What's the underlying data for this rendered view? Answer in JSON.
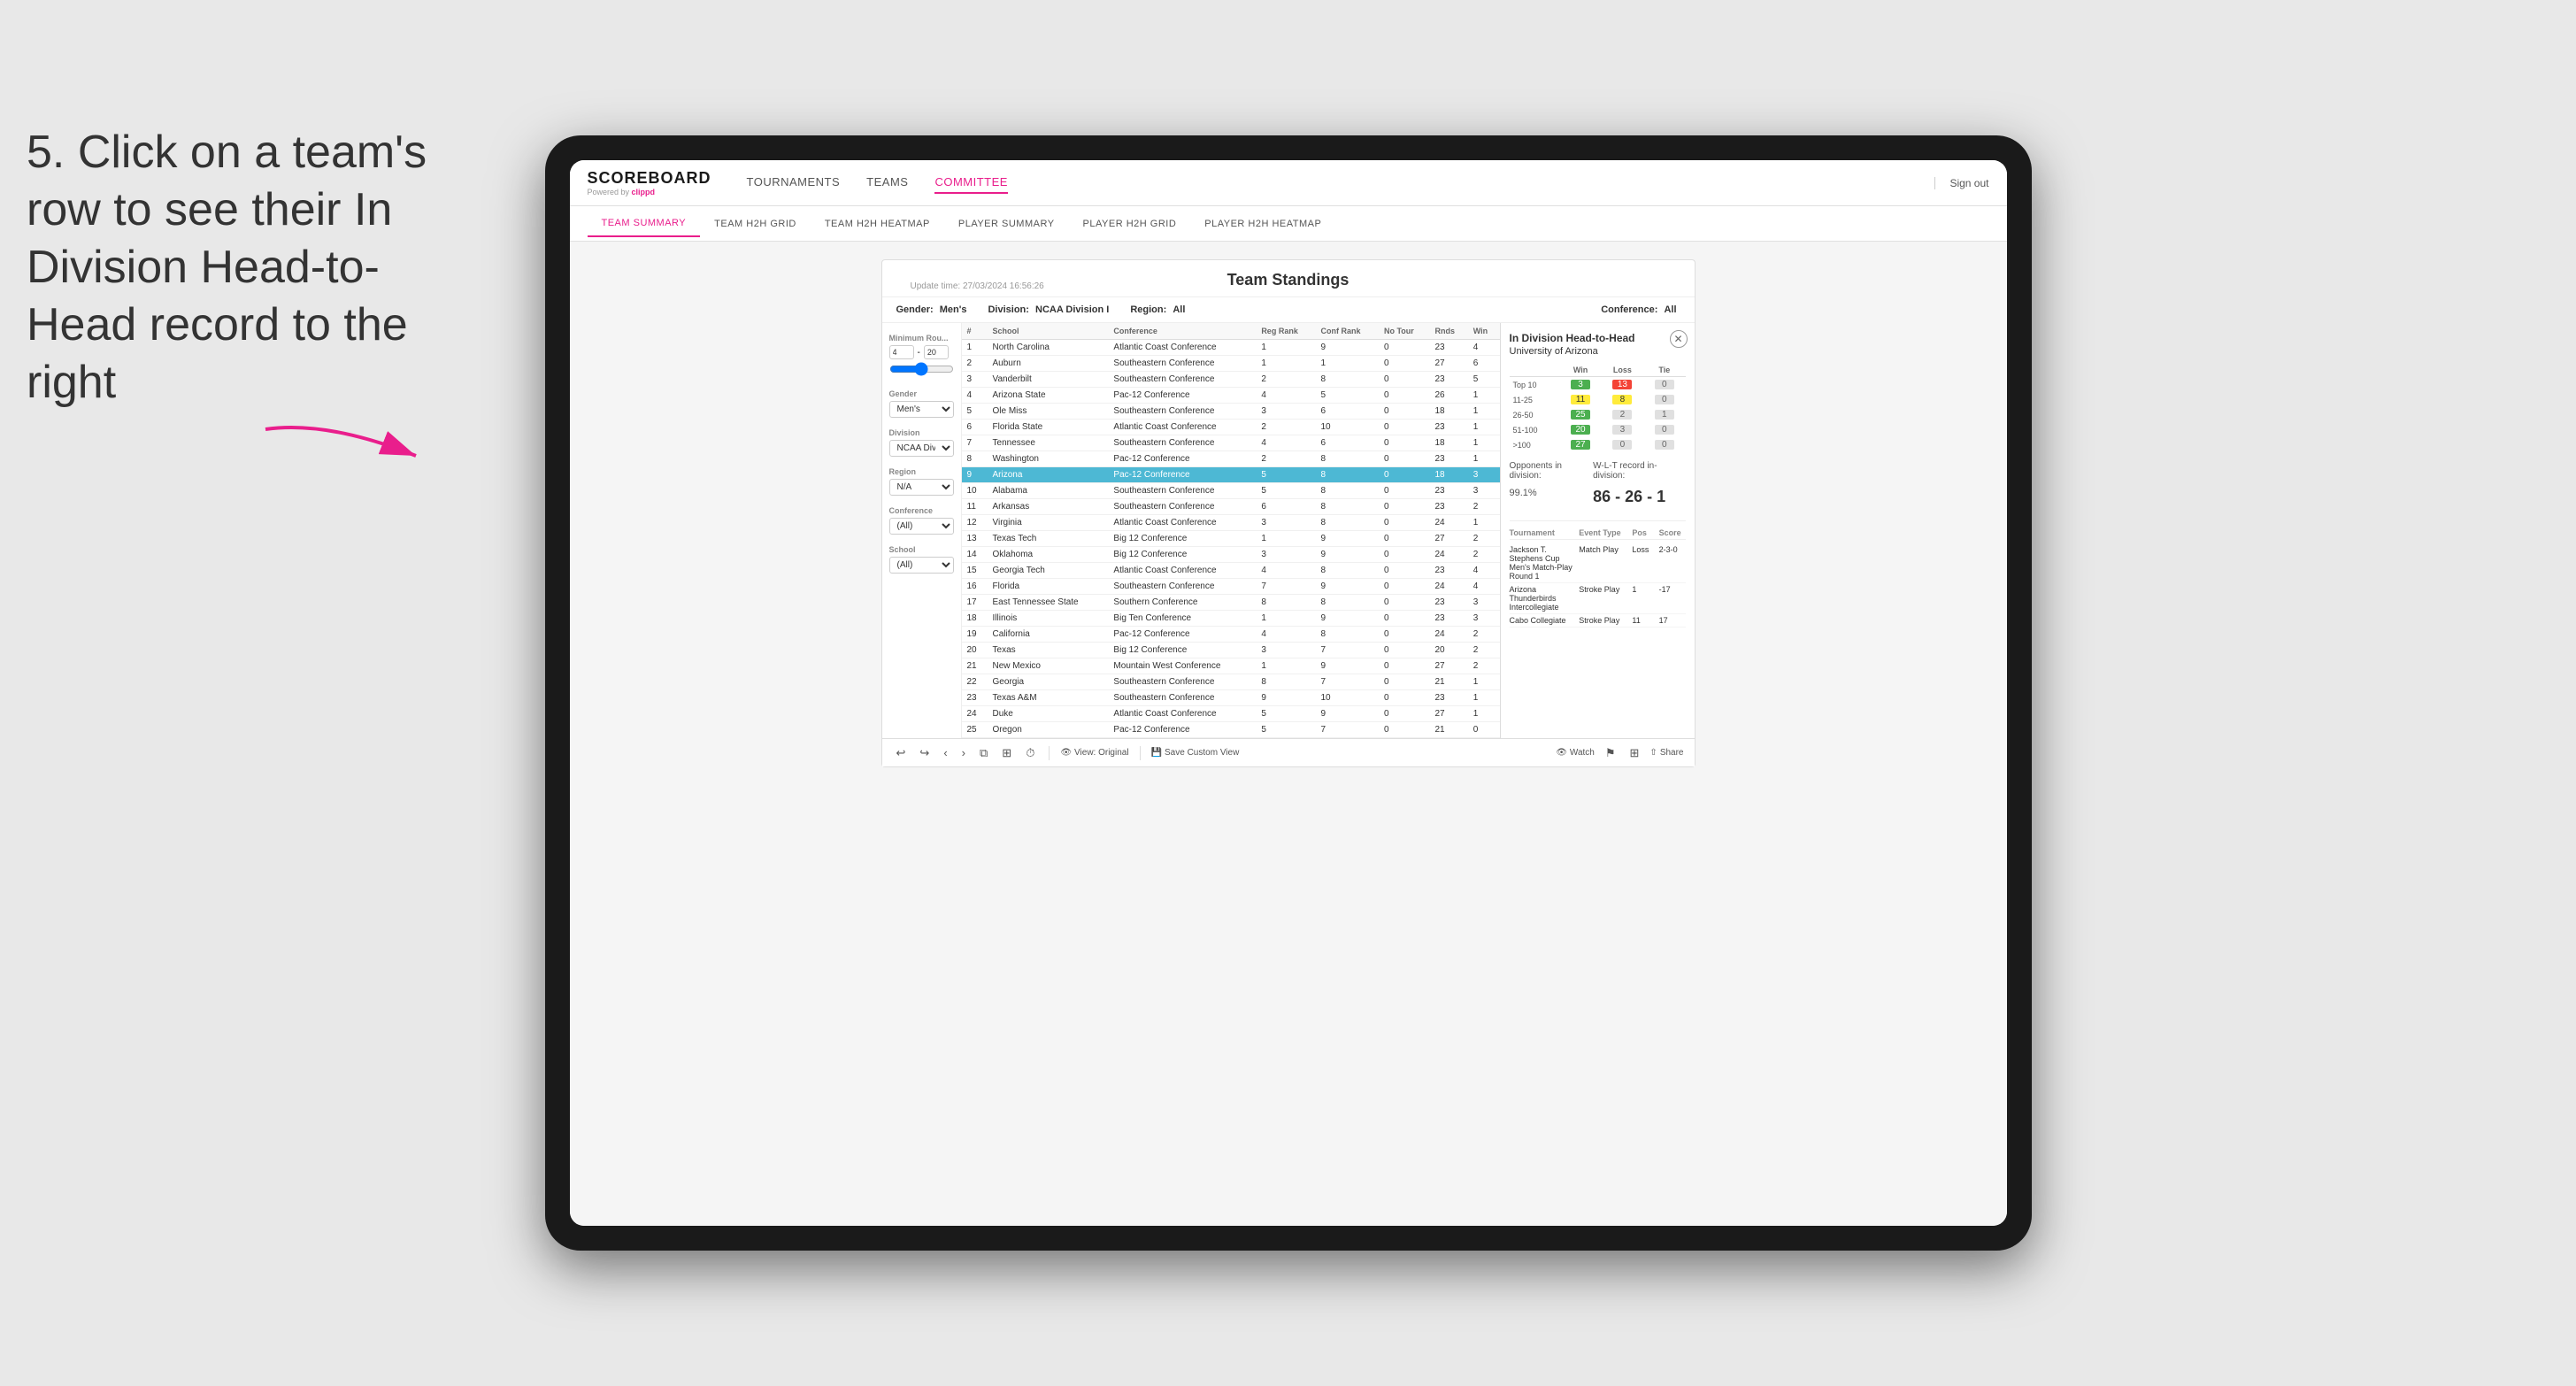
{
  "page": {
    "background": "#e8e8e8"
  },
  "annotation": {
    "text": "5. Click on a team's row to see their In Division Head-to-Head record to the right"
  },
  "nav": {
    "logo": "SCOREBOARD",
    "logo_sub": "Powered by clippd",
    "items": [
      "TOURNAMENTS",
      "TEAMS",
      "COMMITTEE"
    ],
    "sign_out": "Sign out",
    "active_nav": "COMMITTEE"
  },
  "sub_nav": {
    "items": [
      "TEAM SUMMARY",
      "TEAM H2H GRID",
      "TEAM H2H HEATMAP",
      "PLAYER SUMMARY",
      "PLAYER H2H GRID",
      "PLAYER H2H HEATMAP"
    ],
    "active": "PLAYER SUMMARY"
  },
  "dashboard": {
    "update_time": "Update time: 27/03/2024 16:56:26",
    "title": "Team Standings",
    "gender_label": "Gender:",
    "gender_value": "Men's",
    "division_label": "Division:",
    "division_value": "NCAA Division I",
    "region_label": "Region:",
    "region_value": "All",
    "conference_label": "Conference:",
    "conference_value": "All"
  },
  "filters": {
    "min_rounds_label": "Minimum Rou...",
    "min_rounds_min": "4",
    "min_rounds_max": "20",
    "gender_label": "Gender",
    "gender_value": "Men's",
    "division_label": "Division",
    "division_value": "NCAA Division I",
    "region_label": "Region",
    "region_value": "N/A",
    "conference_label": "Conference",
    "conference_value": "(All)",
    "school_label": "School",
    "school_value": "(All)"
  },
  "table": {
    "headers": [
      "#",
      "School",
      "Conference",
      "Reg Rank",
      "Conf Rank",
      "No Tour",
      "Rnds",
      "Win"
    ],
    "rows": [
      {
        "num": "1",
        "school": "North Carolina",
        "conference": "Atlantic Coast Conference",
        "reg_rank": "1",
        "conf_rank": "9",
        "no_tour": "0",
        "rnds": "23",
        "win": "4"
      },
      {
        "num": "2",
        "school": "Auburn",
        "conference": "Southeastern Conference",
        "reg_rank": "1",
        "conf_rank": "1",
        "no_tour": "0",
        "rnds": "27",
        "win": "6"
      },
      {
        "num": "3",
        "school": "Vanderbilt",
        "conference": "Southeastern Conference",
        "reg_rank": "2",
        "conf_rank": "8",
        "no_tour": "0",
        "rnds": "23",
        "win": "5"
      },
      {
        "num": "4",
        "school": "Arizona State",
        "conference": "Pac-12 Conference",
        "reg_rank": "4",
        "conf_rank": "5",
        "no_tour": "0",
        "rnds": "26",
        "win": "1"
      },
      {
        "num": "5",
        "school": "Ole Miss",
        "conference": "Southeastern Conference",
        "reg_rank": "3",
        "conf_rank": "6",
        "no_tour": "0",
        "rnds": "18",
        "win": "1"
      },
      {
        "num": "6",
        "school": "Florida State",
        "conference": "Atlantic Coast Conference",
        "reg_rank": "2",
        "conf_rank": "10",
        "no_tour": "0",
        "rnds": "23",
        "win": "1"
      },
      {
        "num": "7",
        "school": "Tennessee",
        "conference": "Southeastern Conference",
        "reg_rank": "4",
        "conf_rank": "6",
        "no_tour": "0",
        "rnds": "18",
        "win": "1"
      },
      {
        "num": "8",
        "school": "Washington",
        "conference": "Pac-12 Conference",
        "reg_rank": "2",
        "conf_rank": "8",
        "no_tour": "0",
        "rnds": "23",
        "win": "1"
      },
      {
        "num": "9",
        "school": "Arizona",
        "conference": "Pac-12 Conference",
        "reg_rank": "5",
        "conf_rank": "8",
        "no_tour": "0",
        "rnds": "18",
        "win": "3",
        "highlighted": true
      },
      {
        "num": "10",
        "school": "Alabama",
        "conference": "Southeastern Conference",
        "reg_rank": "5",
        "conf_rank": "8",
        "no_tour": "0",
        "rnds": "23",
        "win": "3"
      },
      {
        "num": "11",
        "school": "Arkansas",
        "conference": "Southeastern Conference",
        "reg_rank": "6",
        "conf_rank": "8",
        "no_tour": "0",
        "rnds": "23",
        "win": "2"
      },
      {
        "num": "12",
        "school": "Virginia",
        "conference": "Atlantic Coast Conference",
        "reg_rank": "3",
        "conf_rank": "8",
        "no_tour": "0",
        "rnds": "24",
        "win": "1"
      },
      {
        "num": "13",
        "school": "Texas Tech",
        "conference": "Big 12 Conference",
        "reg_rank": "1",
        "conf_rank": "9",
        "no_tour": "0",
        "rnds": "27",
        "win": "2"
      },
      {
        "num": "14",
        "school": "Oklahoma",
        "conference": "Big 12 Conference",
        "reg_rank": "3",
        "conf_rank": "9",
        "no_tour": "0",
        "rnds": "24",
        "win": "2"
      },
      {
        "num": "15",
        "school": "Georgia Tech",
        "conference": "Atlantic Coast Conference",
        "reg_rank": "4",
        "conf_rank": "8",
        "no_tour": "0",
        "rnds": "23",
        "win": "4"
      },
      {
        "num": "16",
        "school": "Florida",
        "conference": "Southeastern Conference",
        "reg_rank": "7",
        "conf_rank": "9",
        "no_tour": "0",
        "rnds": "24",
        "win": "4"
      },
      {
        "num": "17",
        "school": "East Tennessee State",
        "conference": "Southern Conference",
        "reg_rank": "8",
        "conf_rank": "8",
        "no_tour": "0",
        "rnds": "23",
        "win": "3"
      },
      {
        "num": "18",
        "school": "Illinois",
        "conference": "Big Ten Conference",
        "reg_rank": "1",
        "conf_rank": "9",
        "no_tour": "0",
        "rnds": "23",
        "win": "3"
      },
      {
        "num": "19",
        "school": "California",
        "conference": "Pac-12 Conference",
        "reg_rank": "4",
        "conf_rank": "8",
        "no_tour": "0",
        "rnds": "24",
        "win": "2"
      },
      {
        "num": "20",
        "school": "Texas",
        "conference": "Big 12 Conference",
        "reg_rank": "3",
        "conf_rank": "7",
        "no_tour": "0",
        "rnds": "20",
        "win": "2"
      },
      {
        "num": "21",
        "school": "New Mexico",
        "conference": "Mountain West Conference",
        "reg_rank": "1",
        "conf_rank": "9",
        "no_tour": "0",
        "rnds": "27",
        "win": "2"
      },
      {
        "num": "22",
        "school": "Georgia",
        "conference": "Southeastern Conference",
        "reg_rank": "8",
        "conf_rank": "7",
        "no_tour": "0",
        "rnds": "21",
        "win": "1"
      },
      {
        "num": "23",
        "school": "Texas A&M",
        "conference": "Southeastern Conference",
        "reg_rank": "9",
        "conf_rank": "10",
        "no_tour": "0",
        "rnds": "23",
        "win": "1"
      },
      {
        "num": "24",
        "school": "Duke",
        "conference": "Atlantic Coast Conference",
        "reg_rank": "5",
        "conf_rank": "9",
        "no_tour": "0",
        "rnds": "27",
        "win": "1"
      },
      {
        "num": "25",
        "school": "Oregon",
        "conference": "Pac-12 Conference",
        "reg_rank": "5",
        "conf_rank": "7",
        "no_tour": "0",
        "rnds": "21",
        "win": "0"
      }
    ]
  },
  "h2h_panel": {
    "title": "In Division Head-to-Head",
    "team": "University of Arizona",
    "win_label": "Win",
    "loss_label": "Loss",
    "tie_label": "Tie",
    "ranges": [
      {
        "label": "Top 10",
        "win": "3",
        "loss": "13",
        "tie": "0",
        "win_color": "green",
        "loss_color": "red",
        "tie_color": "gray"
      },
      {
        "label": "11-25",
        "win": "11",
        "loss": "8",
        "tie": "0",
        "win_color": "yellow",
        "loss_color": "yellow",
        "tie_color": "gray"
      },
      {
        "label": "26-50",
        "win": "25",
        "loss": "2",
        "tie": "1",
        "win_color": "green",
        "loss_color": "gray",
        "tie_color": "gray"
      },
      {
        "label": "51-100",
        "win": "20",
        "loss": "3",
        "tie": "0",
        "win_color": "green",
        "loss_color": "gray",
        "tie_color": "gray"
      },
      {
        "label": ">100",
        "win": "27",
        "loss": "0",
        "tie": "0",
        "win_color": "green",
        "loss_color": "gray",
        "tie_color": "gray"
      }
    ],
    "opponents_pct_label": "Opponents in division:",
    "opponents_pct": "99.1%",
    "record_label": "W-L-T record in-division:",
    "record": "86 - 26 - 1",
    "tournament_label": "Tournament",
    "event_type_label": "Event Type",
    "pos_label": "Pos",
    "score_label": "Score",
    "tournaments": [
      {
        "name": "Jackson T. Stephens Cup Men's Match-Play Round 1",
        "type": "Match Play",
        "result": "Loss",
        "pos": "2-3-0"
      },
      {
        "name": "Arizona Thunderbirds Intercollegiate",
        "type": "Stroke Play",
        "pos": "1",
        "score": "-17"
      },
      {
        "name": "Cabo Collegiate",
        "type": "Stroke Play",
        "pos": "11",
        "score": "17"
      }
    ]
  },
  "toolbar": {
    "undo": "↩",
    "redo": "↪",
    "forward": "⟩",
    "view_original": "View: Original",
    "save_custom": "Save Custom View",
    "watch": "Watch",
    "share": "Share"
  }
}
